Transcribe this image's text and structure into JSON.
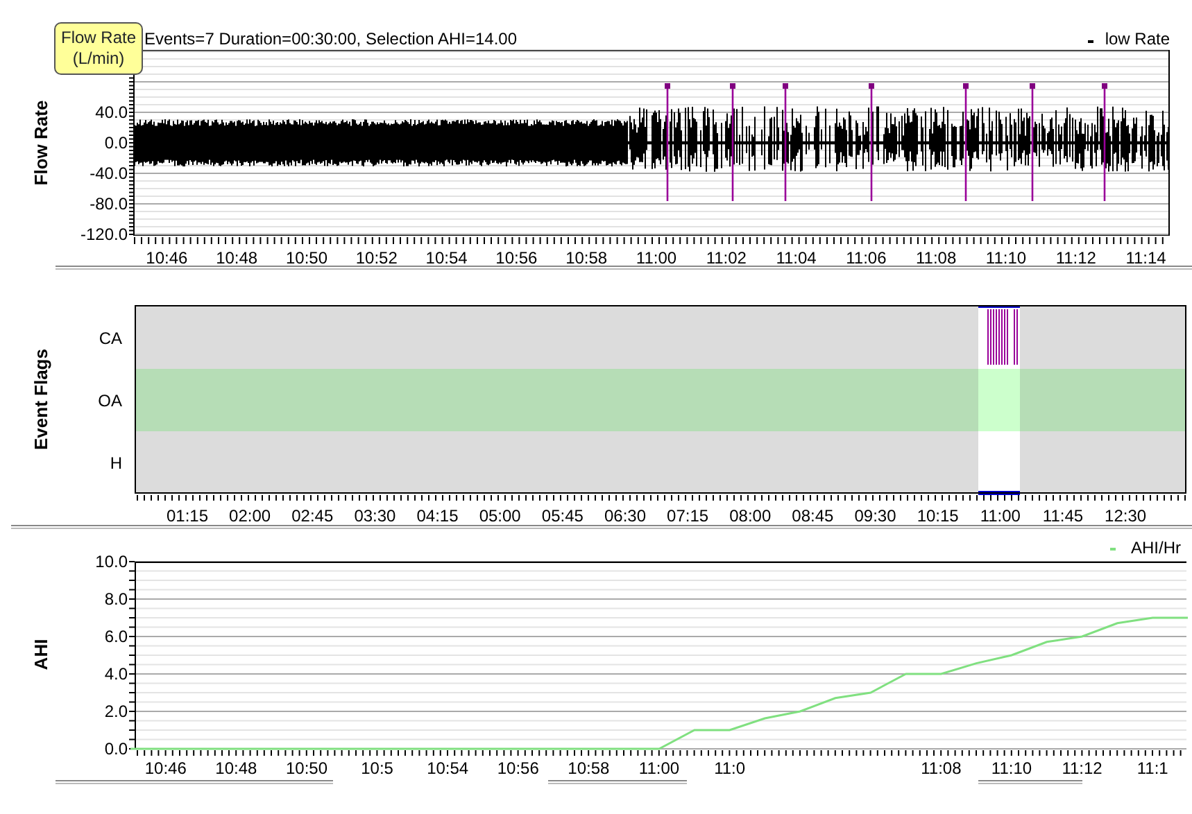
{
  "flow_panel": {
    "axis_title": "Flow Rate",
    "header": "Events=7 Duration=00:30:00, Selection AHI=14.00",
    "legend": "low Rate",
    "tooltip": [
      "Flow Rate",
      "(L/min)"
    ],
    "y_ticks": [
      "40.0",
      "0.0",
      "-40.0",
      "-80.0",
      "-120.0"
    ],
    "time_labels": [
      "10:46",
      "10:48",
      "10:50",
      "10:52",
      "10:54",
      "10:56",
      "10:58",
      "11:00",
      "11:02",
      "11:04",
      "11:06",
      "11:08",
      "11:10",
      "11:12",
      "11:14"
    ]
  },
  "event_panel": {
    "axis_title": "Event Flags",
    "rows": [
      {
        "label": "CA",
        "color": "#dcdcdc"
      },
      {
        "label": "OA",
        "color": "#b6ddb6"
      },
      {
        "label": "H",
        "color": "#dcdcdc"
      }
    ],
    "time_labels": [
      "01:15",
      "02:00",
      "02:45",
      "03:30",
      "04:15",
      "05:00",
      "05:45",
      "06:30",
      "07:15",
      "08:00",
      "08:45",
      "09:30",
      "10:15",
      "11:00",
      "11:45",
      "12:30"
    ]
  },
  "ahi_panel": {
    "chart_data": {
      "type": "line",
      "ylabel": "AHI",
      "grid": true,
      "categories": [
        null,
        "10:46",
        null,
        "10:48",
        null,
        "10:50",
        null,
        "10:5",
        null,
        "10:54",
        null,
        "10:56",
        null,
        "10:58",
        null,
        "11:00",
        null,
        "11:0",
        null,
        null,
        null,
        null,
        null,
        "11:08",
        null,
        "11:10",
        null,
        "11:12",
        null,
        "11:1",
        null
      ],
      "series": [
        {
          "name": "AHI/Hr",
          "color": "#80e080",
          "values": [
            0,
            0,
            0,
            0,
            0,
            0,
            0,
            0,
            0,
            0,
            0,
            0,
            0,
            0,
            0,
            0,
            1,
            1,
            1.63,
            2,
            2.71,
            3,
            4,
            4,
            4.57,
            5,
            5.71,
            6,
            6.71,
            7,
            7
          ]
        }
      ],
      "ylim": [
        0,
        10
      ],
      "yticks": [
        {
          "value": 0,
          "label": "0.0"
        },
        {
          "value": 2,
          "label": "2.0"
        },
        {
          "value": 4,
          "label": "4.0"
        },
        {
          "value": 6,
          "label": "6.0"
        },
        {
          "value": 8,
          "label": "8.0"
        },
        {
          "value": 10,
          "label": "10.0"
        }
      ]
    }
  }
}
